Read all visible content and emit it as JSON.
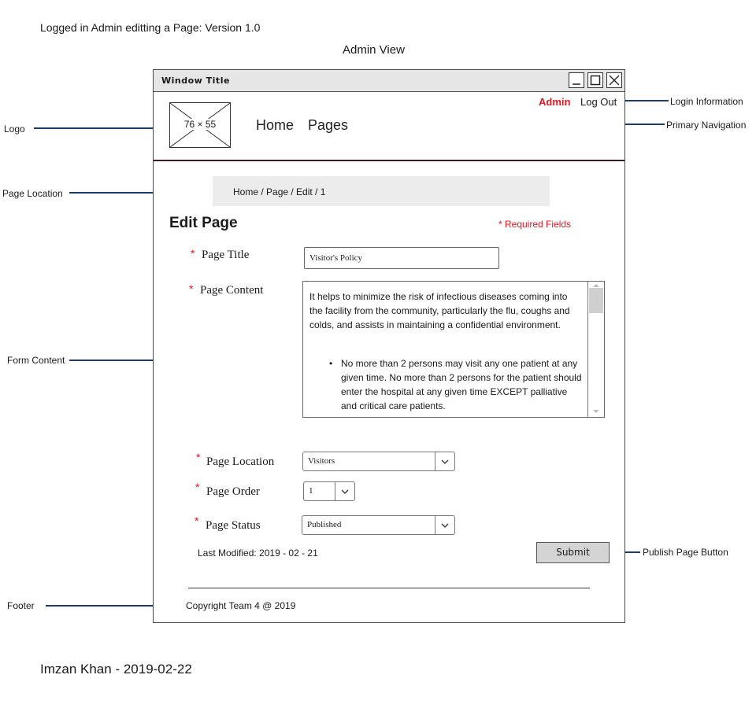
{
  "page": {
    "header_note": "Logged in Admin editting a Page: Version 1.0",
    "view_title": "Admin View",
    "author_note": "Imzan Khan - 2019-02-22"
  },
  "annotations": {
    "logo": "Logo",
    "page_location": "Page Location",
    "form_content": "Form Content",
    "footer": "Footer",
    "login_information": "Login Information",
    "primary_navigation": "Primary Navigation",
    "publish_page_button": "Publish Page Button"
  },
  "window": {
    "title": "Window Title",
    "logo_placeholder": "76 × 55",
    "nav": [
      "Home",
      "Pages"
    ],
    "admin_name": "Admin",
    "logout_label": "Log Out",
    "breadcrumb": "Home / Page / Edit / 1"
  },
  "form": {
    "heading": "Edit Page",
    "required_note": "* Required Fields",
    "required_marker": "*",
    "page_title_label": "Page Title",
    "page_title_value": "Visitor's Policy",
    "page_content_label": "Page Content",
    "page_content_paragraph": "It helps to minimize the risk of infectious diseases coming into the facility from the community, particularly the flu, coughs and colds, and assists in maintaining a confidential environment.",
    "page_content_bullet": "No more than 2 persons may visit any one patient at any given time.  No more than 2 persons for the patient should enter the hospital at any given time EXCEPT palliative and critical care patients.",
    "page_location_label": "Page Location",
    "page_location_value": "Visitors",
    "page_order_label": "Page Order",
    "page_order_value": "1",
    "page_status_label": "Page Status",
    "page_status_value": "Published",
    "last_modified": "Last Modified: 2019 - 02 - 21",
    "submit_label": "Submit"
  },
  "footer": {
    "copyright": "Copyright Team 4 @ 2019"
  },
  "colors": {
    "required_red": "#e8141c",
    "annotation_line": "#1f3a6d"
  },
  "icons": [
    "minimize-icon",
    "maximize-icon",
    "close-icon",
    "chevron-down-icon",
    "image-placeholder-icon"
  ]
}
